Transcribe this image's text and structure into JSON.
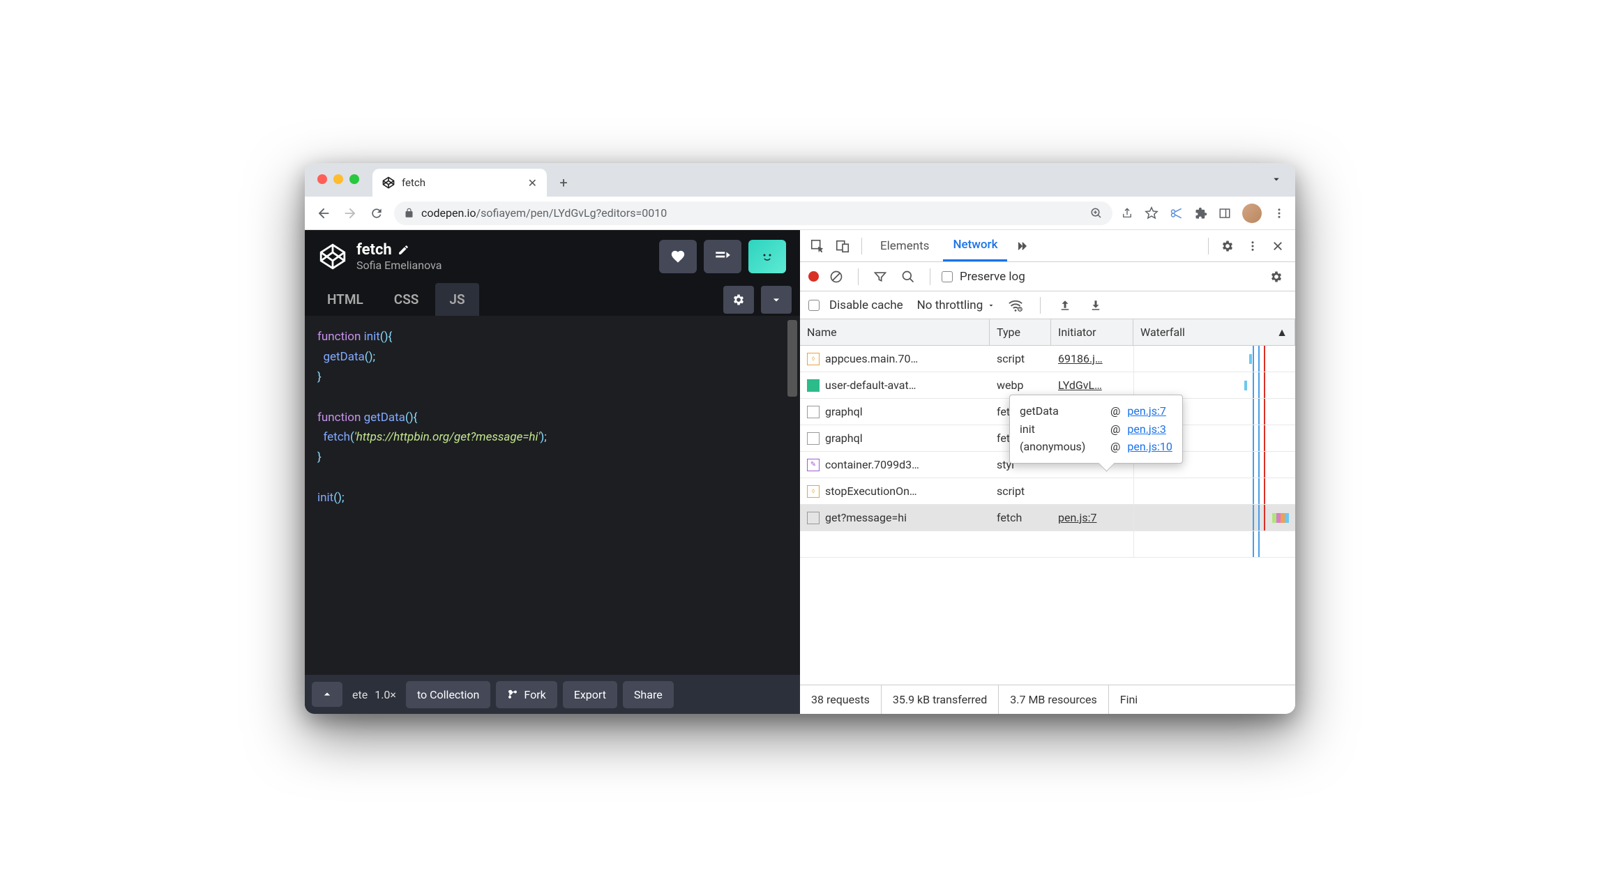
{
  "browser": {
    "tab_title": "fetch",
    "url_domain": "codepen.io",
    "url_path": "/sofiayem/pen/LYdGvLg?editors=0010"
  },
  "codepen": {
    "title": "fetch",
    "author": "Sofia Emelianova",
    "tabs": {
      "html": "HTML",
      "css": "CSS",
      "js": "JS"
    },
    "code": {
      "l1a": "function",
      "l1b": "init",
      "l1c": "(){",
      "l2a": "getData",
      "l2b": "();",
      "l3": "}",
      "l4a": "function",
      "l4b": "getData",
      "l4c": "(){",
      "l5a": "fetch",
      "l5b": "(",
      "l5c": "'https://httpbin.org/get?message=hi'",
      "l5d": ");",
      "l6": "}",
      "l7a": "init",
      "l7b": "();"
    },
    "footer": {
      "zoom_frag": "ete",
      "zoom": "1.0×",
      "to_collection": "to Collection",
      "fork": "Fork",
      "export": "Export",
      "share": "Share"
    }
  },
  "devtools": {
    "tabs": {
      "elements": "Elements",
      "network": "Network"
    },
    "toolbar": {
      "preserve_log": "Preserve log",
      "disable_cache": "Disable cache",
      "throttling": "No throttling"
    },
    "columns": {
      "name": "Name",
      "type": "Type",
      "initiator": "Initiator",
      "waterfall": "Waterfall"
    },
    "rows": [
      {
        "name": "appcues.main.70…",
        "type": "script",
        "initiator": "69186.j…",
        "icon": "js"
      },
      {
        "name": "user-default-avat…",
        "type": "webp",
        "initiator": "LYdGvL…",
        "icon": "img"
      },
      {
        "name": "graphql",
        "type": "fetc",
        "initiator": "",
        "icon": "file"
      },
      {
        "name": "graphql",
        "type": "fetc",
        "initiator": "",
        "icon": "file"
      },
      {
        "name": "container.7099d3…",
        "type": "styl",
        "initiator": "",
        "icon": "css"
      },
      {
        "name": "stopExecutionOn…",
        "type": "script",
        "initiator": "",
        "icon": "js"
      },
      {
        "name": "get?message=hi",
        "type": "fetch",
        "initiator": "pen.js:7",
        "icon": "file",
        "selected": true
      }
    ],
    "tooltip": [
      {
        "fn": "getData",
        "at": "@",
        "link": "pen.js:7"
      },
      {
        "fn": "init",
        "at": "@",
        "link": "pen.js:3"
      },
      {
        "fn": "(anonymous)",
        "at": "@",
        "link": "pen.js:10"
      }
    ],
    "status": {
      "requests": "38 requests",
      "transferred": "35.9 kB transferred",
      "resources": "3.7 MB resources",
      "finish": "Fini"
    }
  }
}
